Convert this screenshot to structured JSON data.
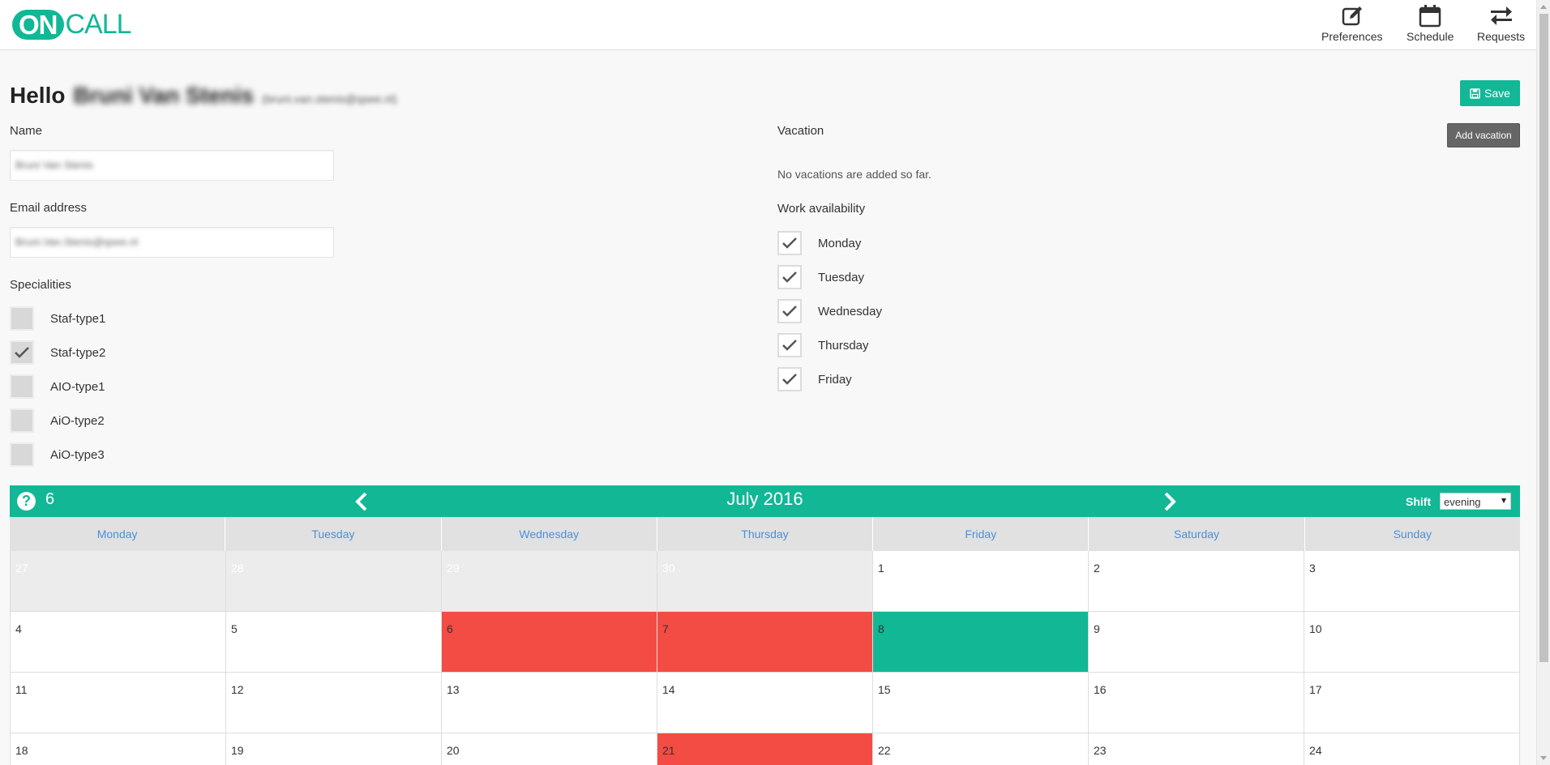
{
  "header": {
    "logo_on": "ON",
    "logo_call": "CALL",
    "nav": [
      {
        "label": "Preferences",
        "icon": "edit-icon"
      },
      {
        "label": "Schedule",
        "icon": "calendar-icon"
      },
      {
        "label": "Requests",
        "icon": "swap-arrows-icon"
      }
    ]
  },
  "profile": {
    "hello": "Hello",
    "name_blurred": "Bruni Van Stenis",
    "email_blurred": "(bruni.van.stenis@qsee.nl)",
    "save_label": "Save",
    "name_label": "Name",
    "name_value": "Bruni Van Stenis",
    "email_label": "Email address",
    "email_value": "Bruni.Van.Stenis@qsee.nl",
    "specialities_label": "Specialities",
    "specialities": [
      {
        "label": "Staf-type1",
        "checked": false
      },
      {
        "label": "Staf-type2",
        "checked": true
      },
      {
        "label": "AIO-type1",
        "checked": false
      },
      {
        "label": "AiO-type2",
        "checked": false
      },
      {
        "label": "AiO-type3",
        "checked": false
      }
    ]
  },
  "vacation": {
    "label": "Vacation",
    "add_label": "Add vacation",
    "empty_text": "No vacations are added so far."
  },
  "availability": {
    "label": "Work availability",
    "days": [
      {
        "label": "Monday",
        "checked": true
      },
      {
        "label": "Tuesday",
        "checked": true
      },
      {
        "label": "Wednesday",
        "checked": true
      },
      {
        "label": "Thursday",
        "checked": true
      },
      {
        "label": "Friday",
        "checked": true
      }
    ]
  },
  "calendar": {
    "help_count": "6",
    "title": "July 2016",
    "shift_label": "Shift",
    "shift_value": "evening",
    "weekdays": [
      "Monday",
      "Tuesday",
      "Wednesday",
      "Thursday",
      "Friday",
      "Saturday",
      "Sunday"
    ],
    "days": [
      {
        "n": "27",
        "state": "prev"
      },
      {
        "n": "28",
        "state": "prev"
      },
      {
        "n": "29",
        "state": "prev"
      },
      {
        "n": "30",
        "state": "prev"
      },
      {
        "n": "1",
        "state": "normal"
      },
      {
        "n": "2",
        "state": "normal"
      },
      {
        "n": "3",
        "state": "normal"
      },
      {
        "n": "4",
        "state": "normal"
      },
      {
        "n": "5",
        "state": "normal"
      },
      {
        "n": "6",
        "state": "red"
      },
      {
        "n": "7",
        "state": "red"
      },
      {
        "n": "8",
        "state": "green"
      },
      {
        "n": "9",
        "state": "normal"
      },
      {
        "n": "10",
        "state": "normal"
      },
      {
        "n": "11",
        "state": "normal"
      },
      {
        "n": "12",
        "state": "normal"
      },
      {
        "n": "13",
        "state": "normal"
      },
      {
        "n": "14",
        "state": "normal"
      },
      {
        "n": "15",
        "state": "normal"
      },
      {
        "n": "16",
        "state": "normal"
      },
      {
        "n": "17",
        "state": "normal"
      },
      {
        "n": "18",
        "state": "normal"
      },
      {
        "n": "19",
        "state": "normal"
      },
      {
        "n": "20",
        "state": "normal"
      },
      {
        "n": "21",
        "state": "red"
      },
      {
        "n": "22",
        "state": "normal"
      },
      {
        "n": "23",
        "state": "normal"
      },
      {
        "n": "24",
        "state": "normal"
      }
    ]
  },
  "colors": {
    "brand": "#12b796",
    "unavailable": "#f24c44",
    "weekday_text": "#4a90d9"
  }
}
